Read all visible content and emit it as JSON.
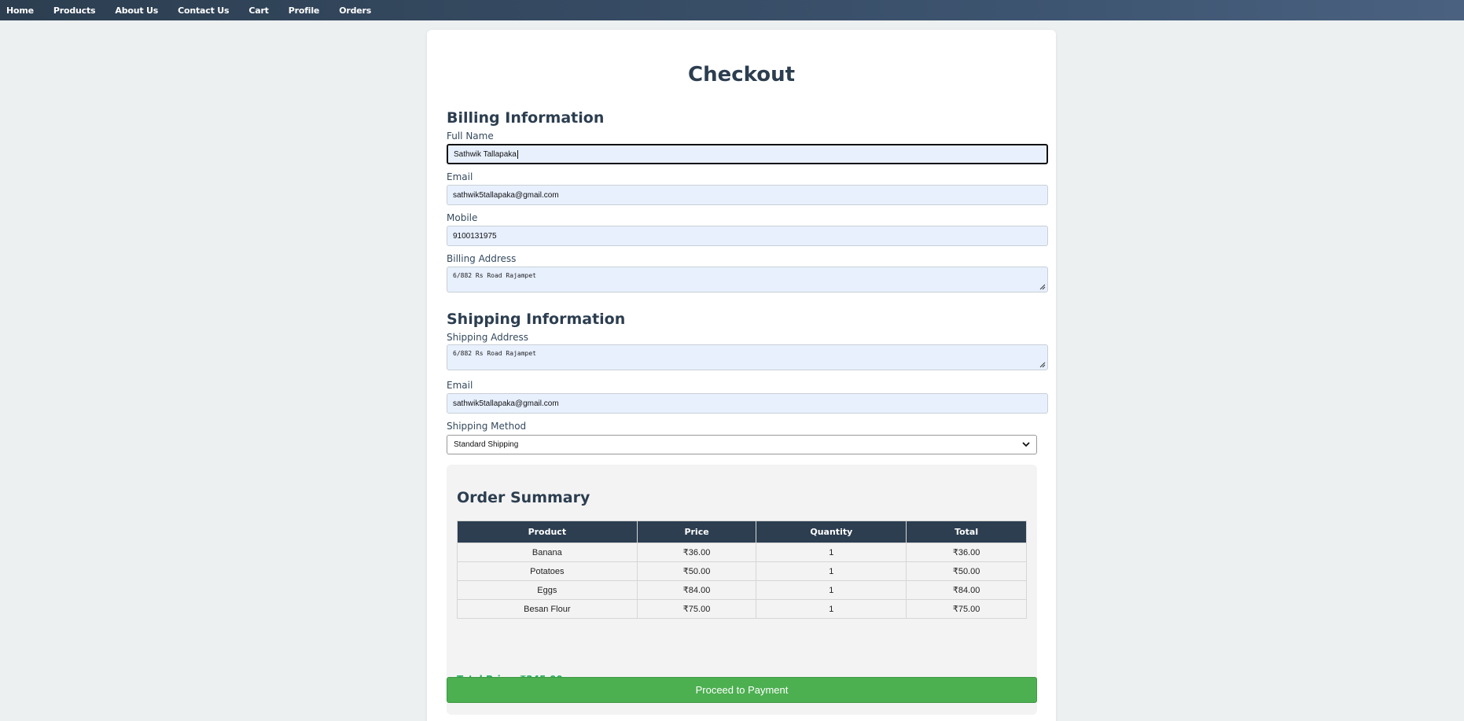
{
  "nav": {
    "items": [
      "Home",
      "Products",
      "About Us",
      "Contact Us",
      "Cart",
      "Profile",
      "Orders"
    ]
  },
  "page": {
    "title": "Checkout"
  },
  "billing": {
    "title": "Billing Information",
    "full_name_label": "Full Name",
    "full_name_value": "Sathwik Tallapaka",
    "email_label": "Email",
    "email_value": "sathwik5tallapaka@gmail.com",
    "mobile_label": "Mobile",
    "mobile_value": "9100131975",
    "address_label": "Billing Address",
    "address_value": "6/882 Rs Road Rajampet"
  },
  "shipping": {
    "title": "Shipping Information",
    "address_label": "Shipping Address",
    "address_value": "6/882 Rs Road Rajampet",
    "email_label": "Email",
    "email_value": "sathwik5tallapaka@gmail.com",
    "method_label": "Shipping Method",
    "method_value": "Standard Shipping"
  },
  "summary": {
    "title": "Order Summary",
    "columns": [
      "Product",
      "Price",
      "Quantity",
      "Total"
    ],
    "rows": [
      [
        "Banana",
        "₹36.00",
        "1",
        "₹36.00"
      ],
      [
        "Potatoes",
        "₹50.00",
        "1",
        "₹50.00"
      ],
      [
        "Eggs",
        "₹84.00",
        "1",
        "₹84.00"
      ],
      [
        "Besan Flour",
        "₹75.00",
        "1",
        "₹75.00"
      ]
    ],
    "total_label": "Total Price: ₹245.00"
  },
  "actions": {
    "pay_label": "Proceed to Payment"
  },
  "colors": {
    "nav_bg": "#2c3e50",
    "heading": "#2c3e50",
    "accent_green": "#4caf50",
    "total_green": "#27ae60",
    "input_bg": "#e8f0fe"
  }
}
